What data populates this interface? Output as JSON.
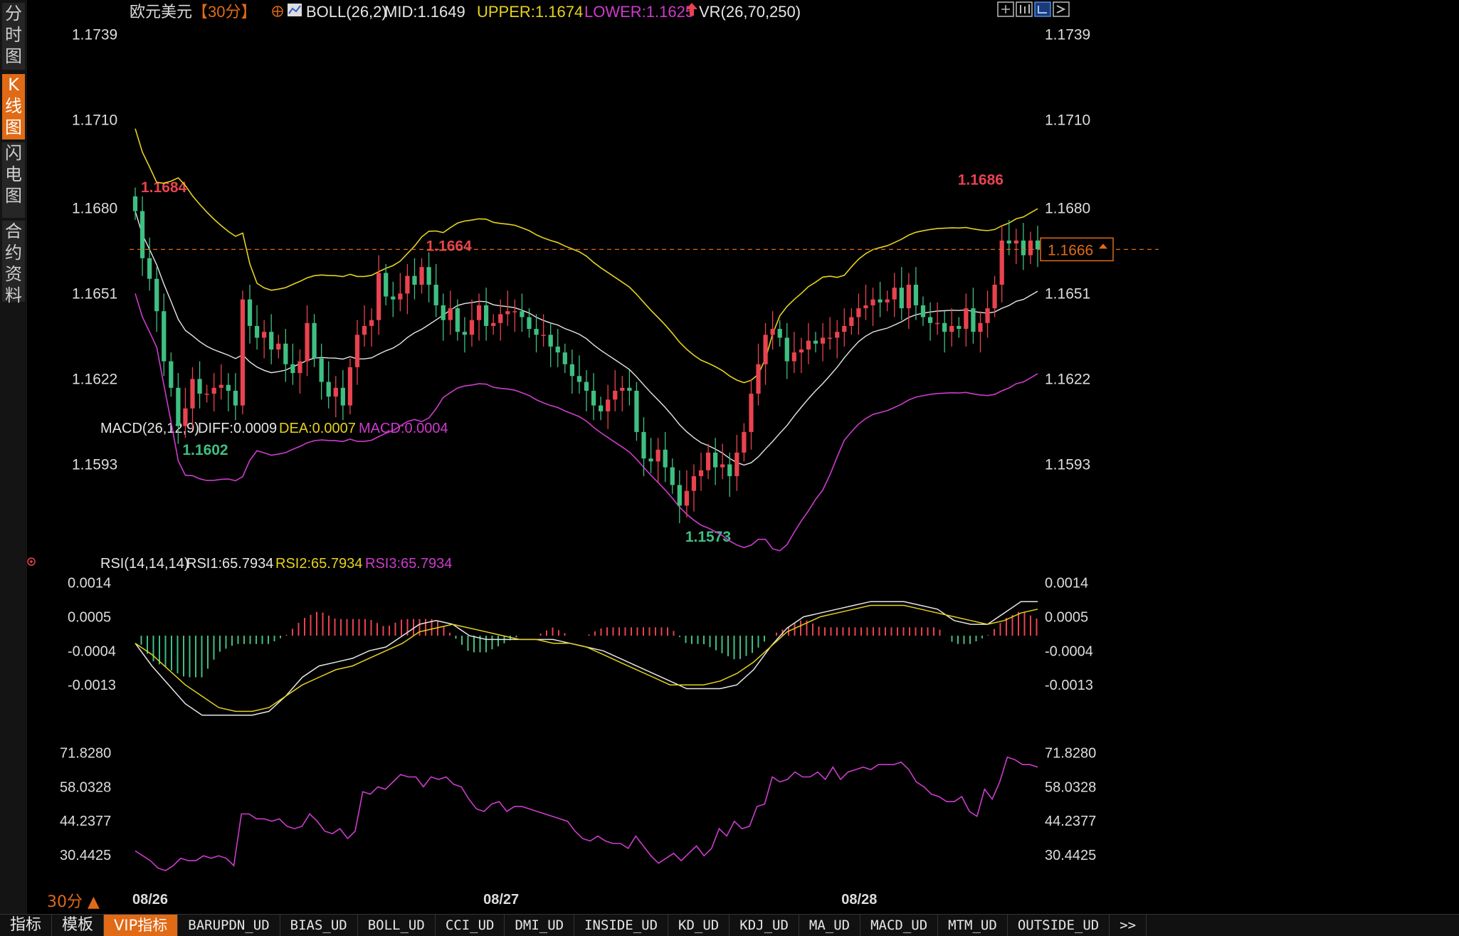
{
  "left_tabs": [
    "分时图",
    "K线图",
    "闪电图",
    "合约资料"
  ],
  "bottom_tabs": [
    "指标",
    "模板",
    "VIP指标",
    "BARUPDN_UD",
    "BIAS_UD",
    "BOLL_UD",
    "CCI_UD",
    "DMI_UD",
    "INSIDE_UD",
    "KD_UD",
    "KDJ_UD",
    "MA_UD",
    "MACD_UD",
    "MTM_UD",
    "OUTSIDE_UD",
    ">>"
  ],
  "period": "30分 ▲",
  "header": {
    "symbol": "欧元美元",
    "period_tag": "【30分】",
    "boll_label": "BOLL(26,2)",
    "mid": "MID:1.1649",
    "upper": "UPPER:1.1674",
    "lower": "LOWER:1.1625",
    "vr": "VR(26,70,250)"
  },
  "colors": {
    "up": "#e8434f",
    "down": "#3fbf82",
    "mid": "#e6e6e6",
    "upper": "#e6d21e",
    "lower": "#cc3ccc",
    "axis": "#dddddd",
    "accent": "#e06a15"
  },
  "chart_data": [
    {
      "type": "candlestick",
      "title": "欧元美元 30分",
      "x_labels": [
        "08/26",
        "08/27",
        "08/28"
      ],
      "y_ticks": [
        "1.1739",
        "1.1710",
        "1.1680",
        "1.1651",
        "1.1622",
        "1.1593"
      ],
      "ylim": [
        1.1567,
        1.1741
      ],
      "current_price": 1.1666,
      "current_price_label": "1.1666",
      "annotations": [
        {
          "text": "1.1684",
          "value": 1.1684
        },
        {
          "text": "1.1602",
          "value": 1.1602
        },
        {
          "text": "1.1664",
          "value": 1.1664
        },
        {
          "text": "1.1573",
          "value": 1.1573
        },
        {
          "text": "1.1686",
          "value": 1.1686
        }
      ],
      "close": [
        1.1679,
        1.1663,
        1.1656,
        1.1645,
        1.1628,
        1.1619,
        1.1606,
        1.1612,
        1.1622,
        1.1617,
        1.1617,
        1.1619,
        1.162,
        1.1618,
        1.1613,
        1.1649,
        1.164,
        1.1636,
        1.1638,
        1.1632,
        1.1634,
        1.1627,
        1.1624,
        1.1628,
        1.1641,
        1.1629,
        1.1621,
        1.1616,
        1.1619,
        1.1613,
        1.1626,
        1.1637,
        1.164,
        1.1642,
        1.1658,
        1.165,
        1.1649,
        1.1651,
        1.1657,
        1.1654,
        1.166,
        1.1654,
        1.1647,
        1.1642,
        1.1646,
        1.1638,
        1.1637,
        1.1642,
        1.1647,
        1.164,
        1.1641,
        1.1644,
        1.1645,
        1.1645,
        1.1643,
        1.1639,
        1.1637,
        1.1637,
        1.1633,
        1.1631,
        1.1627,
        1.1623,
        1.1621,
        1.1618,
        1.1613,
        1.1611,
        1.1615,
        1.1618,
        1.1619,
        1.1618,
        1.1604,
        1.1595,
        1.1594,
        1.1598,
        1.1592,
        1.1586,
        1.1579,
        1.1584,
        1.1589,
        1.1591,
        1.1597,
        1.1592,
        1.1593,
        1.1589,
        1.1597,
        1.1604,
        1.1617,
        1.1627,
        1.1637,
        1.1639,
        1.1636,
        1.1628,
        1.1631,
        1.1632,
        1.1635,
        1.1634,
        1.1636,
        1.1636,
        1.1638,
        1.164,
        1.1643,
        1.1646,
        1.1647,
        1.1649,
        1.1648,
        1.1649,
        1.1653,
        1.1646,
        1.1654,
        1.1647,
        1.1643,
        1.1641,
        1.1641,
        1.1638,
        1.164,
        1.1639,
        1.1646,
        1.1638,
        1.1641,
        1.1646,
        1.1654,
        1.1669,
        1.1668,
        1.1669,
        1.1664,
        1.1669,
        1.1666
      ],
      "series": [
        {
          "name": "MID",
          "value_label": "1.1649"
        },
        {
          "name": "UPPER",
          "value_label": "1.1674"
        },
        {
          "name": "LOWER",
          "value_label": "1.1625"
        }
      ]
    },
    {
      "type": "line",
      "title": "MACD(26,12,9)",
      "y_ticks": [
        "0.0014",
        "0.0005",
        "-0.0004",
        "-0.0013"
      ],
      "ylim": [
        -0.0022,
        0.0016
      ],
      "series": [
        {
          "name": "DIFF",
          "value_label": "DIFF:0.0009",
          "values": [
            -0.0002,
            -0.0008,
            -0.0013,
            -0.0018,
            -0.0021,
            -0.0021,
            -0.0021,
            -0.0021,
            -0.002,
            -0.0016,
            -0.0011,
            -0.0008,
            -0.0007,
            -0.0006,
            -0.0004,
            -0.0003,
            0.0,
            0.0003,
            0.0004,
            0.0003,
            0.0,
            -0.0001,
            -0.0001,
            -0.0001,
            -0.0001,
            -0.0001,
            -0.0002,
            -0.0003,
            -0.0004,
            -0.0006,
            -0.0008,
            -0.001,
            -0.0012,
            -0.0014,
            -0.0014,
            -0.0014,
            -0.0013,
            -0.0009,
            -0.0003,
            0.0002,
            0.0005,
            0.0006,
            0.0007,
            0.0008,
            0.0009,
            0.0009,
            0.0009,
            0.0008,
            0.0007,
            0.0004,
            0.0003,
            0.0003,
            0.0006,
            0.0009,
            0.0009
          ]
        },
        {
          "name": "DEA",
          "value_label": "DEA:0.0007",
          "values": [
            -0.0002,
            -0.0005,
            -0.0009,
            -0.0013,
            -0.0016,
            -0.0019,
            -0.002,
            -0.002,
            -0.0019,
            -0.0016,
            -0.0013,
            -0.0011,
            -0.0009,
            -0.0008,
            -0.0006,
            -0.0004,
            -0.0002,
            0.0001,
            0.0002,
            0.0003,
            0.0002,
            0.0001,
            0.0,
            -0.0001,
            -0.0001,
            -0.0002,
            -0.0002,
            -0.0003,
            -0.0005,
            -0.0007,
            -0.0009,
            -0.0011,
            -0.0013,
            -0.0013,
            -0.0013,
            -0.0012,
            -0.001,
            -0.0007,
            -0.0003,
            0.0001,
            0.0003,
            0.0005,
            0.0006,
            0.0007,
            0.0008,
            0.0008,
            0.0008,
            0.0007,
            0.0006,
            0.0005,
            0.0004,
            0.0003,
            0.0004,
            0.0006,
            0.0007
          ]
        },
        {
          "name": "MACD",
          "value_label": "MACD:0.0004"
        }
      ]
    },
    {
      "type": "line",
      "title": "RSI(14,14,14)",
      "y_ticks": [
        "71.8280",
        "58.0328",
        "44.2377",
        "30.4425"
      ],
      "ylim": [
        22,
        74
      ],
      "series": [
        {
          "name": "RSI1",
          "value_label": "RSI1:65.7934",
          "values": [
            32,
            30,
            28,
            25,
            24,
            26,
            29,
            28,
            28,
            30,
            29,
            30,
            29,
            26,
            47,
            47,
            45,
            45,
            44,
            45,
            42,
            41,
            42,
            47,
            44,
            40,
            39,
            41,
            37,
            40,
            56,
            55,
            58,
            57,
            60,
            63,
            62,
            62,
            58,
            62,
            61,
            62,
            59,
            58,
            53,
            49,
            48,
            51,
            52,
            48,
            50,
            50,
            49,
            48,
            47,
            46,
            45,
            44,
            40,
            37,
            36,
            38,
            36,
            35,
            35,
            33,
            38,
            34,
            30,
            27,
            29,
            31,
            28,
            31,
            34,
            30,
            33,
            41,
            38,
            44,
            41,
            42,
            50,
            51,
            62,
            60,
            61,
            64,
            62,
            62,
            64,
            61,
            66,
            61,
            64,
            65,
            66,
            65,
            67,
            67,
            67,
            68,
            65,
            60,
            58,
            55,
            54,
            52,
            52,
            54,
            48,
            46,
            57,
            53,
            60,
            70,
            69,
            67,
            67,
            66
          ]
        },
        {
          "name": "RSI2",
          "value_label": "RSI2:65.7934"
        },
        {
          "name": "RSI3",
          "value_label": "RSI3:65.7934"
        }
      ]
    }
  ]
}
